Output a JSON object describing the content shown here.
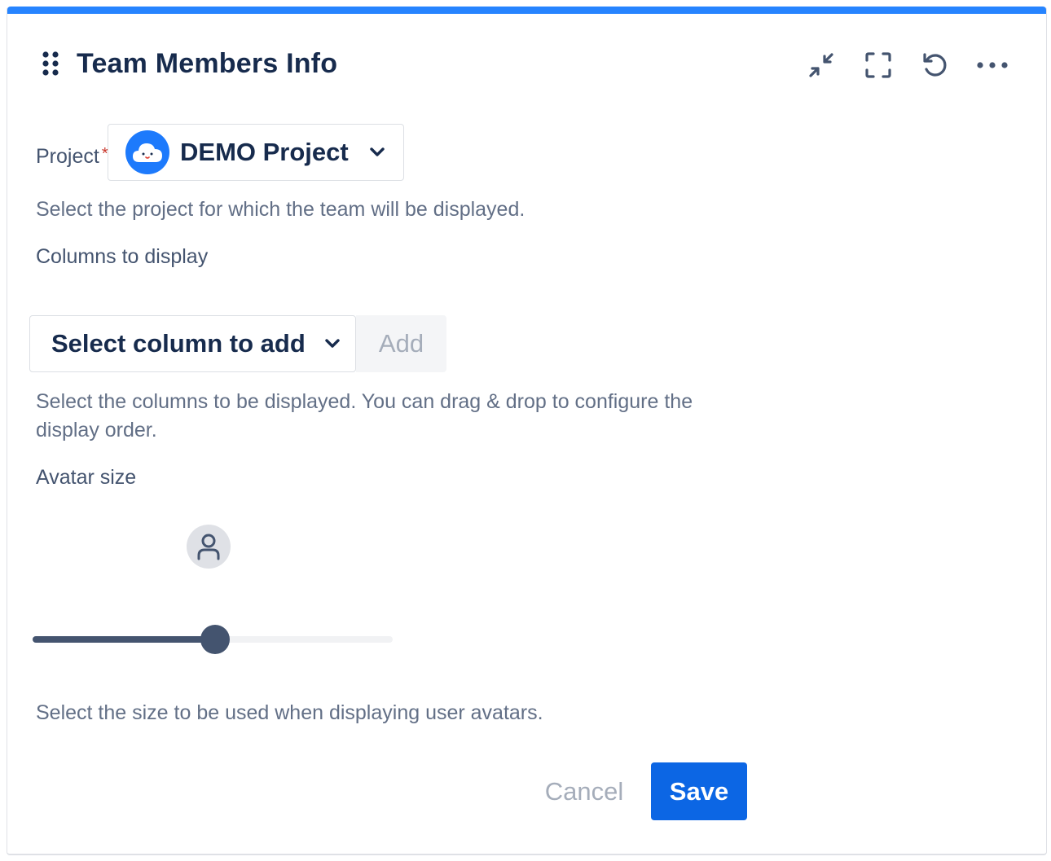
{
  "accent_color": "#2684ff",
  "header": {
    "title": "Team Members Info",
    "actions": [
      "minimize-icon",
      "fullscreen-icon",
      "refresh-icon",
      "more-icon"
    ]
  },
  "project": {
    "label": "Project",
    "required_marker": "*",
    "value": "DEMO Project",
    "help": "Select the project for which the team will be displayed."
  },
  "columns": {
    "label": "Columns to display",
    "select_placeholder": "Select column to add",
    "add_label": "Add",
    "help_line1": "Select the columns to be displayed. You can drag & drop to configure the",
    "help_line2": "display order."
  },
  "avatar_size": {
    "label": "Avatar size",
    "value_fraction": 0.5,
    "help": "Select the size to be used when displaying user avatars."
  },
  "footer": {
    "cancel_label": "Cancel",
    "save_label": "Save",
    "save_color": "#0c66e4"
  }
}
